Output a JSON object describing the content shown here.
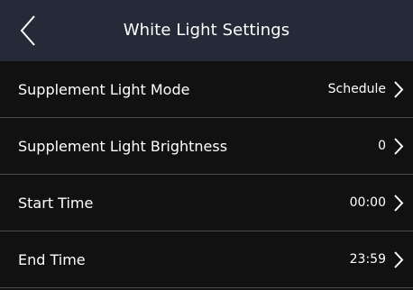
{
  "header": {
    "title": "White Light Settings",
    "back_icon": "chevron-left-icon"
  },
  "settings": [
    {
      "label": "Supplement Light Mode",
      "value": "Schedule",
      "icon": "chevron-right-icon"
    },
    {
      "label": "Supplement Light Brightness",
      "value": "0",
      "icon": "chevron-right-icon"
    },
    {
      "label": "Start Time",
      "value": "00:00",
      "icon": "chevron-right-icon"
    },
    {
      "label": "End Time",
      "value": "23:59",
      "icon": "chevron-right-icon"
    }
  ],
  "colors": {
    "header_bg": "#252a38",
    "body_bg": "#111111",
    "divider": "#4a4a4a",
    "text": "#ffffff"
  }
}
